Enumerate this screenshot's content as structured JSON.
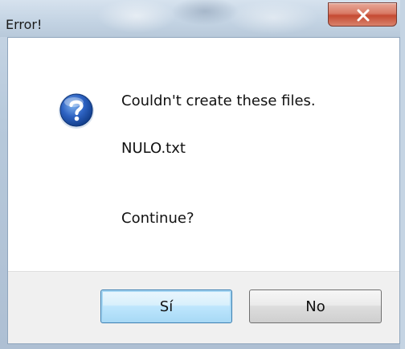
{
  "window": {
    "title": "Error!"
  },
  "dialog": {
    "icon": "question-icon",
    "message_line1": "Couldn't create these files.",
    "file_name": "NULO.txt",
    "prompt": "Continue?"
  },
  "buttons": {
    "yes_label": "Sí",
    "no_label": "No"
  },
  "colors": {
    "close_button": "#c54a32",
    "focused_button_border": "#3c7fb1",
    "icon_blue": "#1f4fa3"
  }
}
